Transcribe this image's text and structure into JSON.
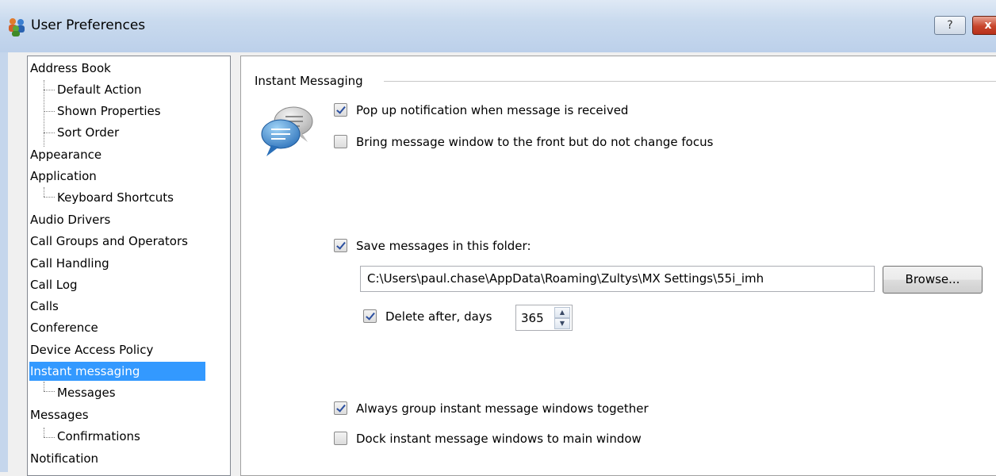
{
  "window": {
    "title": "User Preferences",
    "help_label": "?",
    "close_label": "x"
  },
  "tree": {
    "items": [
      {
        "label": "Address Book"
      },
      {
        "label": "Default Action"
      },
      {
        "label": "Shown Properties"
      },
      {
        "label": "Sort Order"
      },
      {
        "label": "Appearance"
      },
      {
        "label": "Application"
      },
      {
        "label": "Keyboard Shortcuts"
      },
      {
        "label": "Audio Drivers"
      },
      {
        "label": "Call Groups and Operators"
      },
      {
        "label": "Call Handling"
      },
      {
        "label": "Call Log"
      },
      {
        "label": "Calls"
      },
      {
        "label": "Conference"
      },
      {
        "label": "Device Access Policy"
      },
      {
        "label": "Instant messaging",
        "selected": true
      },
      {
        "label": "Messages"
      },
      {
        "label": "Messages"
      },
      {
        "label": "Confirmations"
      },
      {
        "label": "Notification"
      }
    ]
  },
  "panel": {
    "group_title": "Instant Messaging",
    "icon": "chat-bubbles-icon",
    "options": {
      "popup": {
        "label": "Pop up notification when message is received",
        "checked": true
      },
      "bring_front": {
        "label": "Bring message window to the front but do not change focus",
        "checked": false
      },
      "save_messages": {
        "label": "Save messages in this folder:",
        "checked": true
      },
      "delete_after": {
        "label": "Delete after, days",
        "checked": true
      },
      "group_windows": {
        "label": "Always group instant message windows together",
        "checked": true
      },
      "dock_windows": {
        "label": "Dock instant message windows to main window",
        "checked": false
      }
    },
    "folder_path": "C:\\Users\\paul.chase\\AppData\\Roaming\\Zultys\\MX Settings\\55i_imh",
    "browse_label": "Browse...",
    "delete_days": "365"
  },
  "colors": {
    "selection": "#3399ff",
    "titlebar": "#c9daee",
    "check": "#2b4fa0"
  }
}
